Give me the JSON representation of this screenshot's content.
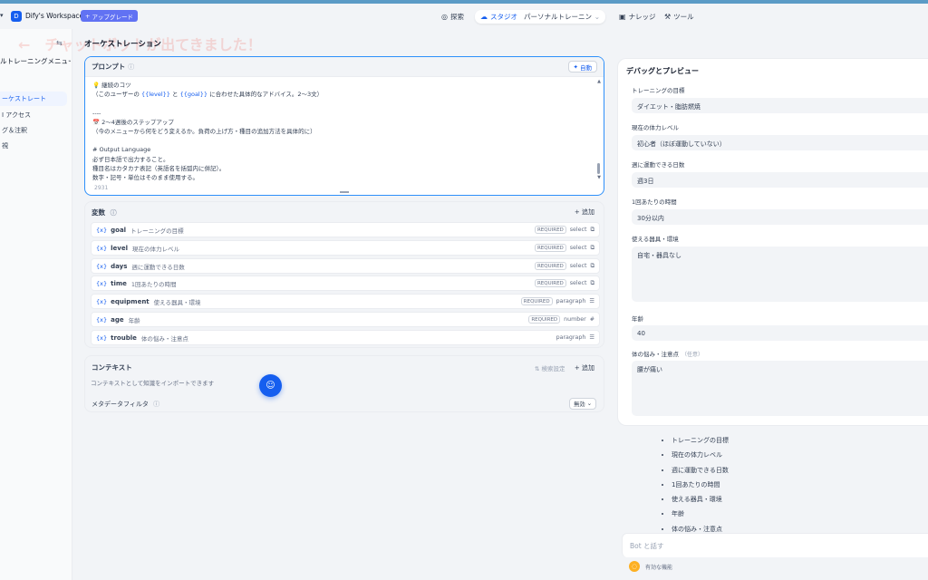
{
  "header": {
    "workspace_chevron": "▾",
    "workspace_badge": "D",
    "workspace_name": "Dify's Workspace",
    "upgrade": "アップグレード",
    "nav_explore": "探索",
    "nav_studio": "スタジオ",
    "studio_app": "パーソナルトレーニングメニ...",
    "nav_knowledge": "ナレッジ",
    "nav_tools": "ツール"
  },
  "sidebar": {
    "app_name": "ルトレーニングメニュー作...",
    "app_sub": "",
    "items": [
      {
        "label": "ーケストレート"
      },
      {
        "label": "I アクセス"
      },
      {
        "label": "グ＆注釈"
      },
      {
        "label": "視"
      }
    ]
  },
  "toast_text": "←　チャットボットが出てきました！",
  "page_title": "オーケストレーション",
  "prompt": {
    "label": "プロンプト",
    "auto_label": "自動",
    "lines": [
      {
        "pre": "💡 継続のコツ",
        "hl": "",
        "post": ""
      },
      {
        "pre": "（このユーザーの ",
        "hl": "{{level}}",
        "mid": " と ",
        "hl2": "{{goal}}",
        "post": " に合わせた具体的なアドバイス。2〜3文）"
      },
      {
        "pre": "",
        "hl": "",
        "post": ""
      },
      {
        "pre": "----",
        "hl": "",
        "post": ""
      },
      {
        "pre": "📅 2〜4週後のステップアップ",
        "hl": "",
        "post": ""
      },
      {
        "pre": "（今のメニューから何をどう変えるか。負荷の上げ方・種目の追加方法を具体的に）",
        "hl": "",
        "post": ""
      },
      {
        "pre": "",
        "hl": "",
        "post": ""
      },
      {
        "pre": "# Output Language",
        "hl": "",
        "post": ""
      },
      {
        "pre": "必ず日本語で出力すること。",
        "hl": "",
        "post": ""
      },
      {
        "pre": "種目名はカタカナ表記（英語名を括弧内に併記）。",
        "hl": "",
        "post": ""
      },
      {
        "pre": "数字・記号・単位はそのまま使用する。",
        "hl": "",
        "post": ""
      }
    ],
    "char_count": "2931"
  },
  "variables": {
    "label": "変数",
    "add": "+ 追加",
    "items": [
      {
        "key": "goal",
        "desc": "トレーニングの目標",
        "required": "REQUIRED",
        "type": "select",
        "icon": "⧉"
      },
      {
        "key": "level",
        "desc": "現在の体力レベル",
        "required": "REQUIRED",
        "type": "select",
        "icon": "⧉"
      },
      {
        "key": "days",
        "desc": "週に運動できる日数",
        "required": "REQUIRED",
        "type": "select",
        "icon": "⧉"
      },
      {
        "key": "time",
        "desc": "1回あたりの時間",
        "required": "REQUIRED",
        "type": "select",
        "icon": "⧉"
      },
      {
        "key": "equipment",
        "desc": "使える器具・環境",
        "required": "REQUIRED",
        "type": "paragraph",
        "icon": "☰"
      },
      {
        "key": "age",
        "desc": "年齢",
        "required": "REQUIRED",
        "type": "number",
        "icon": "#"
      },
      {
        "key": "trouble",
        "desc": "体の悩み・注意点",
        "required": "",
        "type": "paragraph",
        "icon": "☰"
      }
    ]
  },
  "context": {
    "label": "コンテキスト",
    "settings": "⇅ 検索設定",
    "add": "+ 追加",
    "hint": "コンテキストとして知識をインポートできます",
    "metadata_label": "メタデータフィルタ",
    "metadata_value": "無効"
  },
  "debug": {
    "title": "デバッグとプレビュー",
    "fields": [
      {
        "label": "トレーニングの目標",
        "value": "ダイエット・脂肪燃焼",
        "optional": ""
      },
      {
        "label": "現在の体力レベル",
        "value": "初心者（ほぼ運動していない）",
        "optional": ""
      },
      {
        "label": "週に運動できる日数",
        "value": "週3日",
        "optional": ""
      },
      {
        "label": "1回あたりの時間",
        "value": "30分以内",
        "optional": ""
      },
      {
        "label": "使える器具・環境",
        "value": "自宅・器具なし",
        "optional": ""
      },
      {
        "label": "年齢",
        "value": "40",
        "optional": ""
      },
      {
        "label": "体の悩み・注意点",
        "value": "腰が痛い",
        "optional": "（任意）"
      }
    ]
  },
  "chat_bullets": [
    "トレーニングの目標",
    "現在の体力レベル",
    "週に運動できる日数",
    "1回あたりの時間",
    "使える器具・環境",
    "年齢",
    "体の悩み・注意点"
  ],
  "chat_input_placeholder": "Bot と話す",
  "features_label": "有効な機能"
}
